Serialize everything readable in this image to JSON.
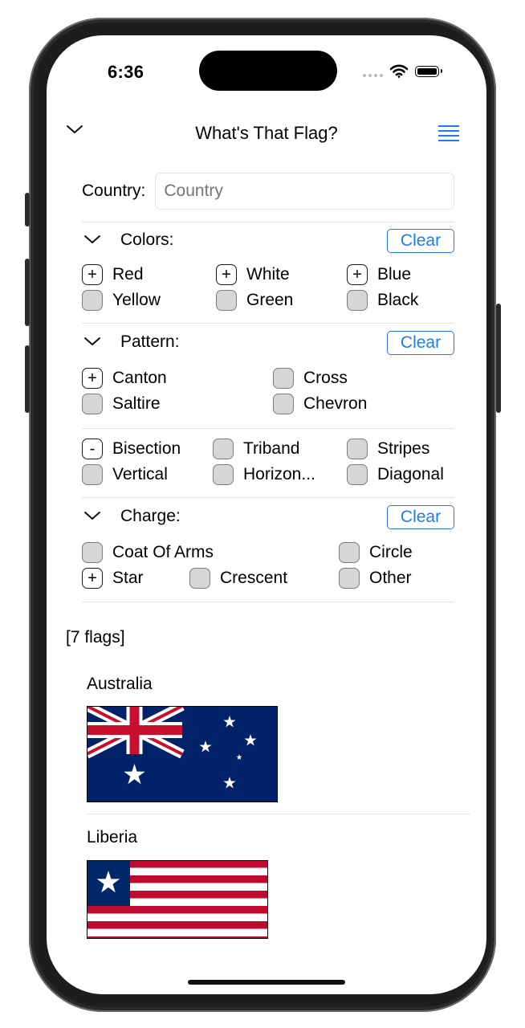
{
  "status": {
    "time": "6:36"
  },
  "nav": {
    "title": "What's That Flag?"
  },
  "country": {
    "label": "Country:",
    "placeholder": "Country"
  },
  "colors": {
    "title": "Colors:",
    "clear": "Clear",
    "options": [
      {
        "sym": "+",
        "label": "Red"
      },
      {
        "sym": "+",
        "label": "White"
      },
      {
        "sym": "+",
        "label": "Blue"
      },
      {
        "sym": "",
        "label": "Yellow"
      },
      {
        "sym": "",
        "label": "Green"
      },
      {
        "sym": "",
        "label": "Black"
      }
    ]
  },
  "pattern": {
    "title": "Pattern:",
    "clear": "Clear",
    "options": [
      {
        "sym": "+",
        "label": "Canton"
      },
      {
        "sym": "",
        "label": "Cross"
      },
      {
        "sym": "",
        "label": "Saltire"
      },
      {
        "sym": "",
        "label": "Chevron"
      }
    ],
    "extra": [
      {
        "sym": "-",
        "label": "Bisection"
      },
      {
        "sym": "",
        "label": "Triband"
      },
      {
        "sym": "",
        "label": "Stripes"
      },
      {
        "sym": "",
        "label": "Vertical"
      },
      {
        "sym": "",
        "label": "Horizon..."
      },
      {
        "sym": "",
        "label": "Diagonal"
      }
    ]
  },
  "charge": {
    "title": "Charge:",
    "clear": "Clear",
    "options": [
      {
        "sym": "",
        "label": "Coat Of Arms"
      },
      {
        "sym": "",
        "label": "Circle"
      },
      {
        "sym": "+",
        "label": "Star"
      },
      {
        "sym": "",
        "label": "Crescent"
      },
      {
        "sym": "",
        "label": "Other"
      }
    ]
  },
  "results": {
    "count": "[7 flags]",
    "flags": [
      {
        "name": "Australia"
      },
      {
        "name": "Liberia"
      }
    ]
  },
  "colors_hex": {
    "accent": "#1f7cf0",
    "australia_blue": "#012169",
    "flag_red": "#c8102e",
    "liberia_red": "#bf0a30",
    "liberia_blue": "#002868"
  }
}
